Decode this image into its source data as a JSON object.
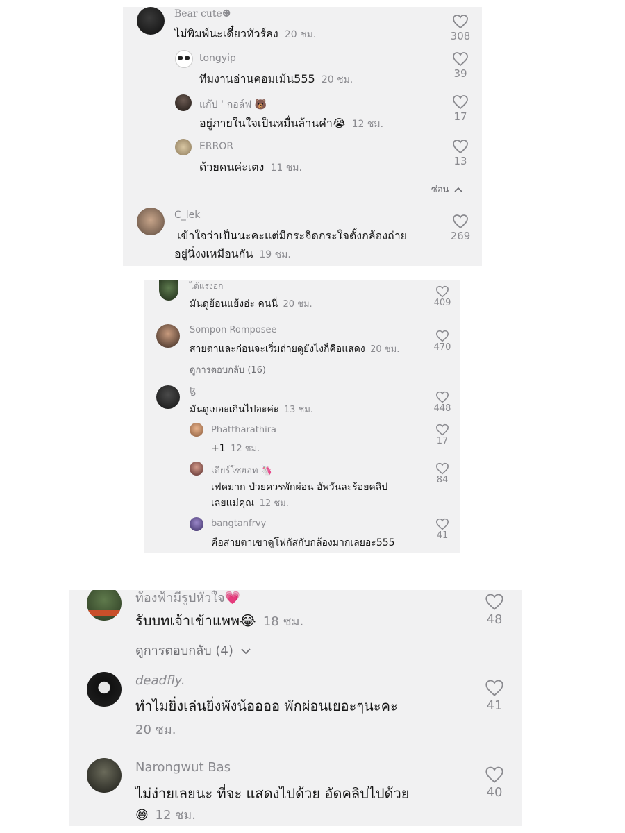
{
  "panel1": {
    "comments": [
      {
        "user": "Bear cute☻",
        "text": "ไม่พิมพ์นะเดี๋ยวทัวร์ลง",
        "time": "20 ชม.",
        "likes": "308"
      },
      {
        "user": "tongyip",
        "text": "ทีมงานอ่านคอมเม้น555",
        "time": "20 ชม.",
        "likes": "39"
      },
      {
        "user": "แก๊ป ‘ กอล์ฟ 🐻",
        "text": "อยู่ภายในใจเป็นหมื่นล้านคำ😭",
        "time": "12 ชม.",
        "likes": "17"
      },
      {
        "user": "ERROR",
        "text": "ด้วยคนค่ะเตง",
        "time": "11 ชม.",
        "likes": "13"
      },
      {
        "user": "C_lek",
        "text_line1": "เข้าใจว่าเป็นนะคะแต่มีกระจิดกระใจตั้งกล้องถ่าย",
        "text_line2": "อยู่นิ่งงเหมือนกัน",
        "time": "19 ชม.",
        "likes": "269"
      }
    ],
    "hide_label": "ซ่อน"
  },
  "panel2": {
    "comments": [
      {
        "user": "ได้แรงอก",
        "text": "มันดูย้อนแย้งอ่ะ คนนี่",
        "time": "20 ชม.",
        "likes": "409"
      },
      {
        "user": "Sompon Romposee",
        "text": "สายตาและก่อนจะเริ่มถ่ายดูยังไงก็คือแสดง",
        "time": "20 ชม.",
        "likes": "470"
      },
      {
        "user": "ꜩ",
        "text": "มันดูเยอะเกินไปอะค่ะ",
        "time": "13 ชม.",
        "likes": "448"
      },
      {
        "user": "Phattharathira",
        "text": "+1",
        "time": "12 ชม.",
        "likes": "17"
      },
      {
        "user": "เดียร์โซฮอท 🦄",
        "text_line1": "เฟคมาก ป่วยควรพักผ่อน อัพวันละร้อยคลิป",
        "text_line2": "เลยแม่คุณ",
        "time": "12 ชม.",
        "likes": "84"
      },
      {
        "user": "bangtanfrvy",
        "text": "คือสายตาเขาดูโฟกัสกับกล้องมากเลยอะ555",
        "likes": "41"
      }
    ],
    "view_replies": "ดูการตอบกลับ (16)"
  },
  "panel3": {
    "comments": [
      {
        "user": "ท้องฟ้ามีรูปหัวใจ💗",
        "text": "รับบทเจ้าเข้าแพพ😂",
        "time": "18 ชม.",
        "likes": "48"
      },
      {
        "user": "deadfly.",
        "text": "ทำไมยิ่งเล่นยิ่งพังน้ออออ พักผ่อนเยอะๆนะคะ",
        "time": "20 ชม.",
        "likes": "41"
      },
      {
        "user": "Narongwut Bas",
        "text": "ไม่ง่ายเลยนะ ที่จะ แสดงไปด้วย อัดคลิปไปด้วย",
        "text_line2_emoji": "😅",
        "time": "12 ชม.",
        "likes": "40"
      }
    ],
    "view_replies": "ดูการตอบกลับ (4)"
  },
  "icons": {
    "like": "heart-outline-icon",
    "hide": "chevron-up-icon",
    "expand": "chevron-down-icon"
  },
  "colors": {
    "panel_bg": "#f1f1f2",
    "text": "#161616",
    "muted": "#8a8a8f"
  }
}
